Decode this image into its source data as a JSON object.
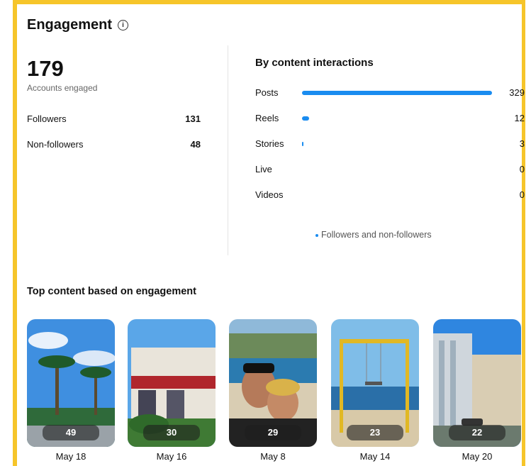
{
  "header": {
    "title": "Engagement"
  },
  "summary": {
    "total": "179",
    "total_label": "Accounts engaged",
    "rows": [
      {
        "label": "Followers",
        "value": "131"
      },
      {
        "label": "Non-followers",
        "value": "48"
      }
    ]
  },
  "interactions": {
    "title": "By content interactions",
    "items": [
      {
        "label": "Posts",
        "value": 329
      },
      {
        "label": "Reels",
        "value": 12
      },
      {
        "label": "Stories",
        "value": 3
      },
      {
        "label": "Live",
        "value": 0
      },
      {
        "label": "Videos",
        "value": 0
      }
    ],
    "legend": "Followers and non-followers",
    "bar_color": "#1a8cf0"
  },
  "top_content": {
    "title": "Top content based on engagement",
    "cards": [
      {
        "count": "49",
        "date": "May 18"
      },
      {
        "count": "30",
        "date": "May 16"
      },
      {
        "count": "29",
        "date": "May 8"
      },
      {
        "count": "23",
        "date": "May 14"
      },
      {
        "count": "22",
        "date": "May 20"
      }
    ]
  },
  "colors": {
    "frame": "#f6c52a",
    "accent": "#1a8cf0"
  }
}
